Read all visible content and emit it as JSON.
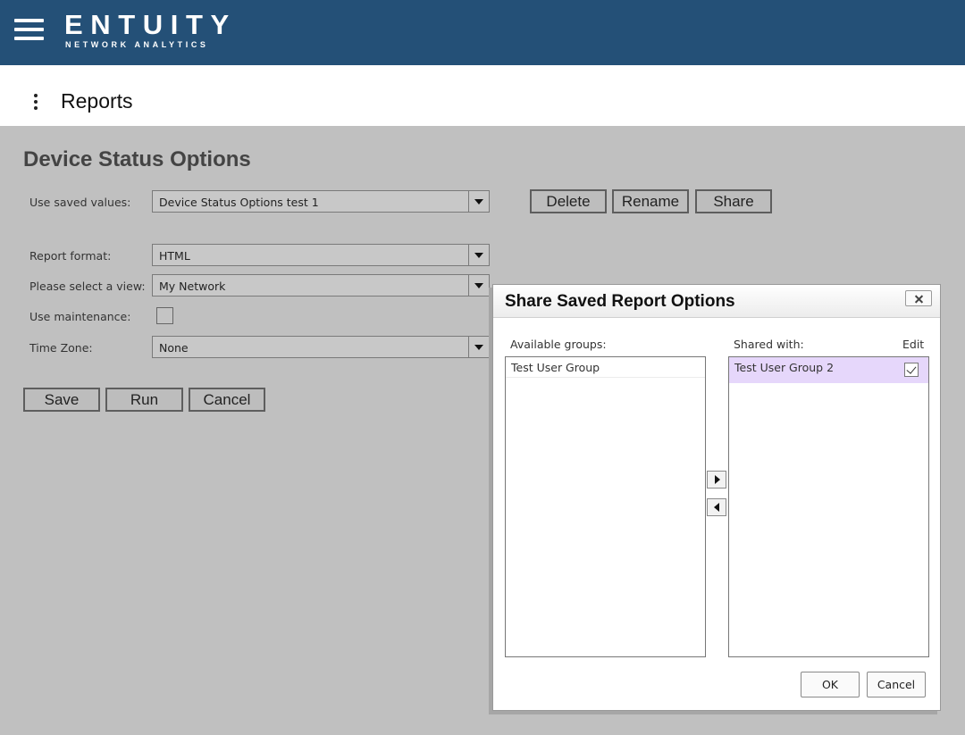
{
  "brand": {
    "name": "ENTUITY",
    "tagline": "NETWORK ANALYTICS"
  },
  "icons": {
    "menu": "hamburger-menu-icon",
    "more": "vertical-dots-icon",
    "dropdown": "dropdown-arrow-icon",
    "close": "close-x-icon",
    "move_right": "arrow-right-icon",
    "move_left": "arrow-left-icon",
    "checkmark": "checkmark-icon"
  },
  "colors": {
    "topbar": "#245077",
    "page_bg": "#c0c0c0",
    "selected_row": "#e6d7fb"
  },
  "page": {
    "title": "Reports"
  },
  "form": {
    "title": "Device Status Options",
    "saved_values": {
      "label": "Use saved values:",
      "value": "Device Status Options test 1"
    },
    "saved_actions": {
      "delete": "Delete",
      "rename": "Rename",
      "share": "Share"
    },
    "report_format": {
      "label": "Report format:",
      "value": "HTML"
    },
    "view": {
      "label": "Please select a view:",
      "value": "My Network"
    },
    "maintenance": {
      "label": "Use maintenance:",
      "checked": false
    },
    "timezone": {
      "label": "Time Zone:",
      "value": "None"
    },
    "actions": {
      "save": "Save",
      "run": "Run",
      "cancel": "Cancel"
    }
  },
  "dialog": {
    "title": "Share Saved Report Options",
    "available_label": "Available groups:",
    "available_groups": [
      "Test User Group"
    ],
    "shared_label": "Shared with:",
    "edit_label": "Edit",
    "shared_groups": [
      {
        "name": "Test User Group 2",
        "edit": true,
        "selected": true
      }
    ],
    "ok": "OK",
    "cancel": "Cancel"
  }
}
